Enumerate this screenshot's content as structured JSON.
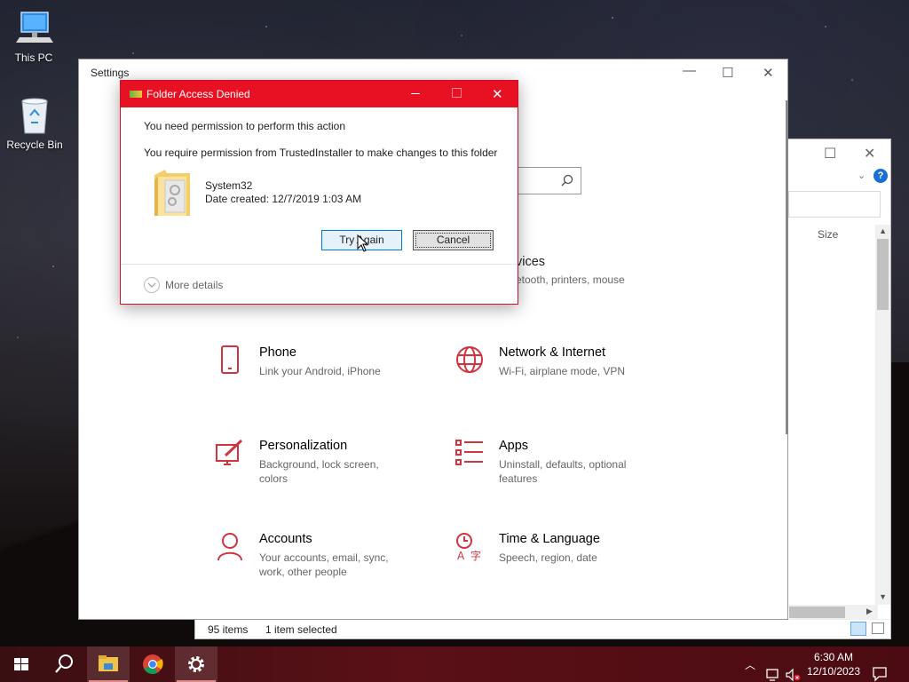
{
  "desktop": {
    "icons": [
      {
        "label": "This PC"
      },
      {
        "label": "Recycle Bin"
      }
    ]
  },
  "explorer": {
    "column_size": "Size",
    "status_items": "95 items",
    "status_selected": "1 item selected"
  },
  "settings": {
    "title": "Settings",
    "partial_tile": {
      "title": "vices",
      "subtitle": "etooth, printers, mouse"
    },
    "tiles": [
      {
        "title": "Phone",
        "subtitle": "Link your Android, iPhone",
        "icon": "phone-icon"
      },
      {
        "title": "Network & Internet",
        "subtitle": "Wi-Fi, airplane mode, VPN",
        "icon": "globe-icon"
      },
      {
        "title": "Personalization",
        "subtitle": "Background, lock screen, colors",
        "icon": "paintbrush-icon"
      },
      {
        "title": "Apps",
        "subtitle": "Uninstall, defaults, optional features",
        "icon": "apps-list-icon"
      },
      {
        "title": "Accounts",
        "subtitle": "Your accounts, email, sync, work, other people",
        "icon": "person-icon"
      },
      {
        "title": "Time & Language",
        "subtitle": "Speech, region, date",
        "icon": "time-language-icon"
      }
    ]
  },
  "dialog": {
    "title": "Folder Access Denied",
    "message": "You need permission to perform this action",
    "detail": "You require permission from TrustedInstaller to make changes to this folder",
    "folder_name": "System32",
    "folder_date": "Date created: 12/7/2019 1:03 AM",
    "try_again_label": "Try Again",
    "cancel_label": "Cancel",
    "more_details_label": "More details"
  },
  "taskbar": {
    "time": "6:30 AM",
    "date": "12/10/2023"
  },
  "colors": {
    "accent_red": "#e81123",
    "settings_icon_red": "#d1343f",
    "taskbar": "#4a0c12"
  }
}
